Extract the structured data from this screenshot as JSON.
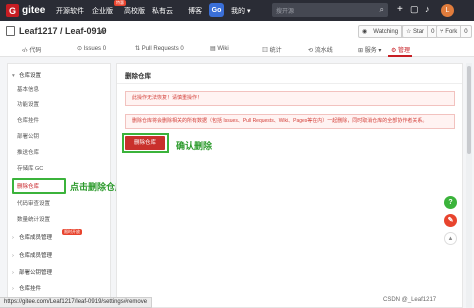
{
  "topnav": {
    "logo_letter": "G",
    "logo_text": "gitee",
    "items": [
      "开源软件",
      "企业版",
      "高校版",
      "博客",
      "我的"
    ],
    "badge": "特惠",
    "go_label": "Go",
    "search_placeholder": "搜开源",
    "avatar_letter": "L",
    "background": "#2a2c35"
  },
  "repo": {
    "title": "Leaf1217 / Leaf-0919",
    "buttons": [
      {
        "label": "Watching",
        "count": "1"
      },
      {
        "label": "Star",
        "count": "0"
      },
      {
        "label": "Fork",
        "count": "0"
      }
    ]
  },
  "tabs": [
    "代码",
    "Issues",
    "Pull Requests",
    "Wiki",
    "统计",
    "流水线",
    "服务",
    "管理"
  ],
  "tab_counts": [
    "0",
    "0"
  ],
  "sidebar": {
    "group1": "仓库设置",
    "items": [
      "基本信息",
      "功能设置",
      "仓库挂件",
      "部署公钥",
      "推送仓库",
      "存储库 GC",
      "删除仓库",
      "代码审查设置",
      "数量统计设置"
    ],
    "active_index": 6,
    "group2": "仓库成员管理",
    "group2_badge": "限时开放",
    "group3": "仓库成员管理",
    "group4": "部署公钥管理",
    "group5": "仓库挂件"
  },
  "main": {
    "title": "删除仓库",
    "warning": "此操作无法恢复！请慎重操作！",
    "info": "删除仓库将会删除相关的所有数据（包括 Issues、Pull Requests、Wiki、Pages等在内）一起删除，同时取消仓库的全部协作者关系。",
    "delete_button": "删除仓库"
  },
  "annotations": {
    "confirm": "确认删除",
    "click": "点击删除仓库"
  },
  "statusbar_url": "https://gitee.com/Leaf1217/leaf-0919/settings#remove",
  "watermark": "CSDN @_Leaf1217",
  "colors": {
    "accent": "#c71d23",
    "annotation_green": "#3bb33b",
    "delete_button": "#c9302c"
  }
}
